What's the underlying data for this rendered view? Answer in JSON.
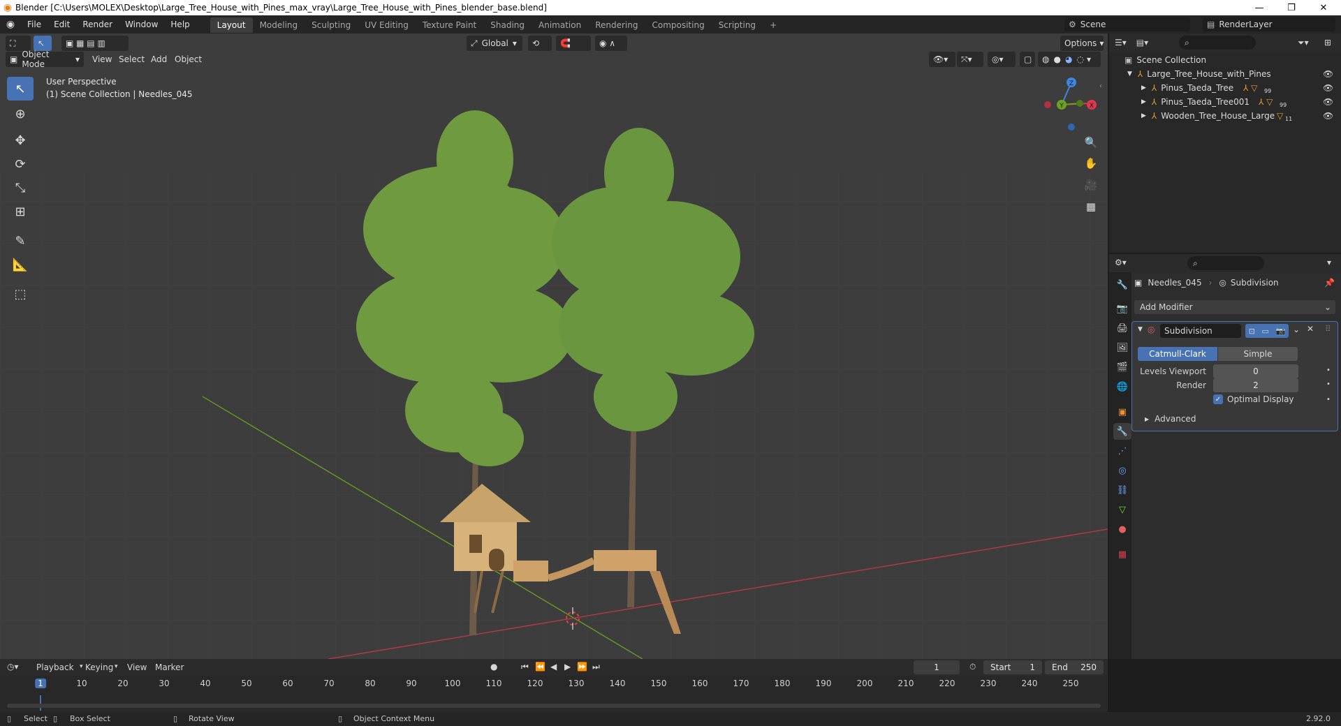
{
  "window": {
    "title": "Blender [C:\\Users\\MOLEX\\Desktop\\Large_Tree_House_with_Pines_max_vray\\Large_Tree_House_with_Pines_blender_base.blend]",
    "minimize": "—",
    "restore": "❐",
    "close": "✕"
  },
  "menu": [
    "File",
    "Edit",
    "Render",
    "Window",
    "Help"
  ],
  "workspaces": [
    "Layout",
    "Modeling",
    "Sculpting",
    "UV Editing",
    "Texture Paint",
    "Shading",
    "Animation",
    "Rendering",
    "Compositing",
    "Scripting"
  ],
  "workspace_active": "Layout",
  "add_workspace": "+",
  "scene": {
    "name": "Scene",
    "render_layer": "RenderLayer"
  },
  "viewport": {
    "mode": "Object Mode",
    "menus": [
      "View",
      "Select",
      "Add",
      "Object"
    ],
    "orientation": "Global",
    "options": "Options",
    "perspective": "User Perspective",
    "context": "(1) Scene Collection | Needles_045",
    "gizmo": {
      "x": "X",
      "y": "Y",
      "z": "Z"
    }
  },
  "outliner": {
    "root": "Scene Collection",
    "items": [
      {
        "name": "Large_Tree_House_with_Pines",
        "level": 0,
        "badge": ""
      },
      {
        "name": "Pinus_Taeda_Tree",
        "level": 1,
        "badge": "99"
      },
      {
        "name": "Pinus_Taeda_Tree001",
        "level": 1,
        "badge": "99"
      },
      {
        "name": "Wooden_Tree_House_Large",
        "level": 1,
        "badge": "11"
      }
    ]
  },
  "properties": {
    "object_name": "Needles_045",
    "modifier_context": "Subdivision",
    "add_modifier": "Add Modifier",
    "modifier": {
      "name": "Subdivision",
      "types": [
        "Catmull-Clark",
        "Simple"
      ],
      "active_type": "Catmull-Clark",
      "levels_viewport_label": "Levels Viewport",
      "levels_viewport": "0",
      "render_label": "Render",
      "render": "2",
      "optimal_display": "Optimal Display",
      "advanced": "Advanced"
    }
  },
  "timeline": {
    "menus": [
      "Playback",
      "Keying",
      "View",
      "Marker"
    ],
    "current_frame": "1",
    "start_label": "Start",
    "start": "1",
    "end_label": "End",
    "end": "250",
    "ticks": [
      "1",
      "10",
      "20",
      "30",
      "40",
      "50",
      "60",
      "70",
      "80",
      "90",
      "100",
      "110",
      "120",
      "130",
      "140",
      "150",
      "160",
      "170",
      "180",
      "190",
      "200",
      "210",
      "220",
      "230",
      "240",
      "250"
    ]
  },
  "status": {
    "select": "Select",
    "box_select": "Box Select",
    "rotate_view": "Rotate View",
    "context_menu": "Object Context Menu",
    "version": "2.92.0"
  },
  "colors": {
    "accent": "#4772b3",
    "x_axis": "#e0384f",
    "y_axis": "#6ba31f",
    "z_axis": "#3d87e0",
    "foliage": "#6f9a3f"
  }
}
